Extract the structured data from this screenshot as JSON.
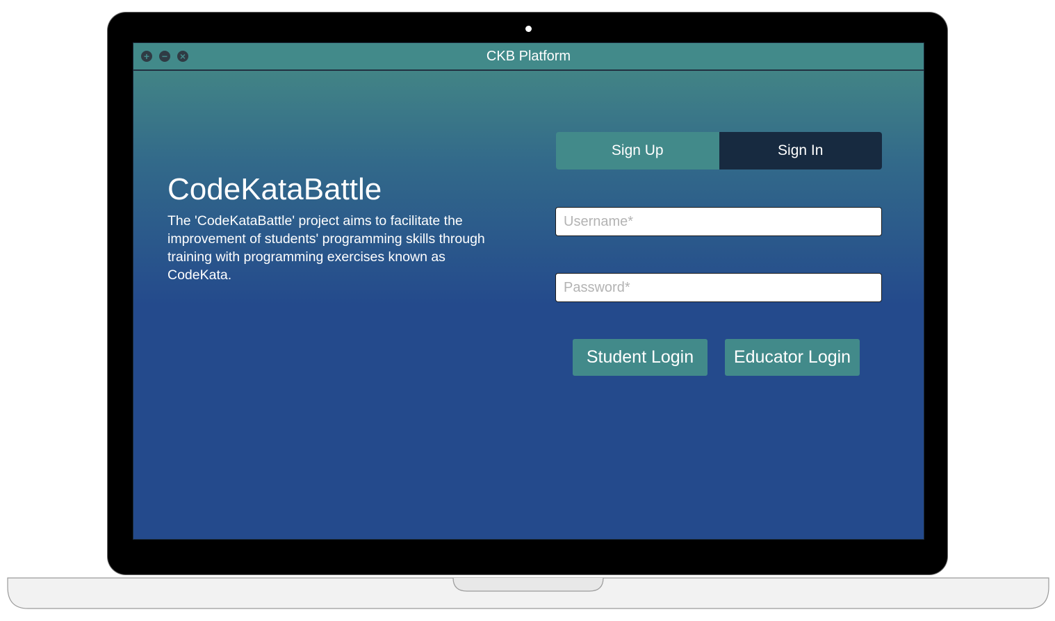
{
  "window": {
    "title": "CKB Platform",
    "controls": [
      {
        "name": "add-icon",
        "glyph": "+"
      },
      {
        "name": "minimize-icon",
        "glyph": "−"
      },
      {
        "name": "close-icon",
        "glyph": "×"
      }
    ]
  },
  "hero": {
    "title": "CodeKataBattle",
    "description": "The 'CodeKataBattle' project aims to facilitate the improvement of students' programming skills through training with programming exercises known as CodeKata."
  },
  "auth": {
    "tabs": {
      "sign_up": "Sign Up",
      "sign_in": "Sign In",
      "active": "sign_in"
    },
    "username": {
      "placeholder": "Username*",
      "value": ""
    },
    "password": {
      "placeholder": "Password*",
      "value": ""
    },
    "buttons": {
      "student_login": "Student Login",
      "educator_login": "Educator Login"
    }
  },
  "colors": {
    "accent": "#428a8a",
    "active_tab": "#172a40",
    "background": "#244a8c"
  }
}
